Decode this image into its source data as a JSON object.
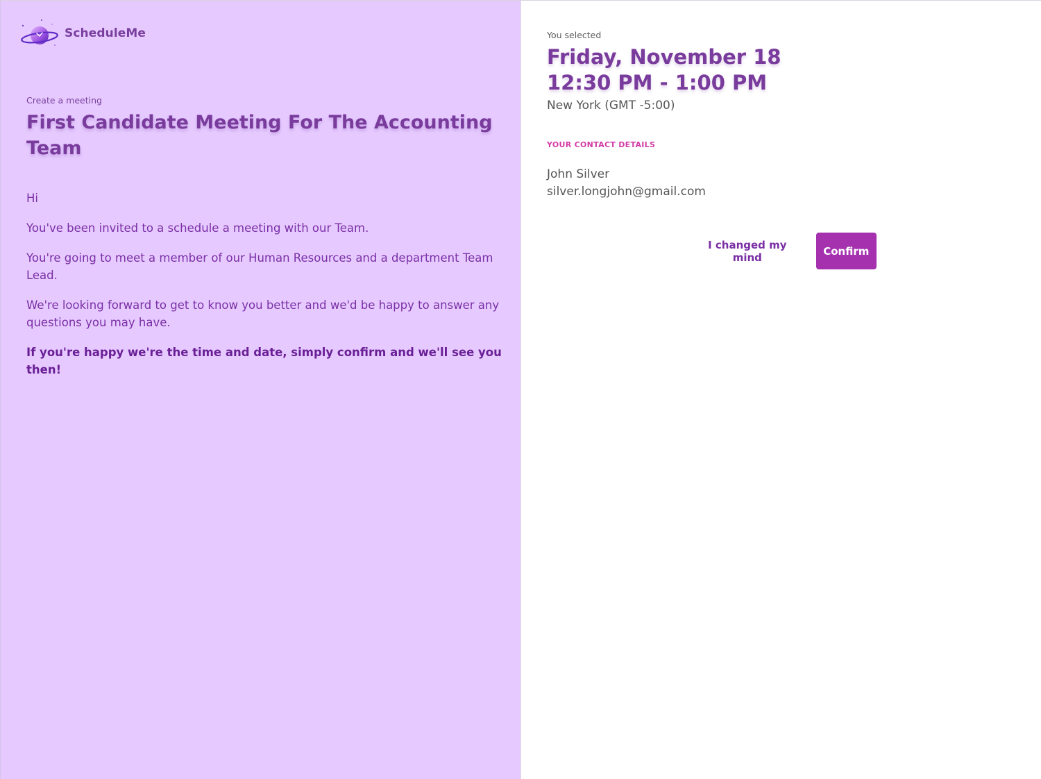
{
  "brand": {
    "name": "ScheduleMe",
    "logo_icon": "planet-clock-icon"
  },
  "meeting": {
    "eyebrow": "Create a meeting",
    "title": "First Candidate Meeting For The Accounting Team",
    "paragraphs": [
      "Hi",
      "You've been invited to a schedule a meeting with our Team.",
      "You're going to meet a member of our Human Resources and a department Team Lead.",
      "We're looking forward to get to know you better and we'd be happy to answer any questions you may have.",
      "If you're happy we're the time and date, simply confirm and we'll see you then!"
    ]
  },
  "selection": {
    "label": "You selected",
    "date": "Friday, November 18",
    "time": "12:30 PM - 1:00 PM",
    "timezone": "New York (GMT -5:00)"
  },
  "contact": {
    "section_label": "YOUR CONTACT DETAILS",
    "name": "John Silver",
    "email": "silver.longjohn@gmail.com"
  },
  "actions": {
    "secondary_label": "I changed my mind",
    "primary_label": "Confirm"
  },
  "colors": {
    "left_panel_bg": "#e6caff",
    "primary_accent": "#a531af",
    "heading": "#793b9c",
    "section_label": "#d23ba6"
  }
}
